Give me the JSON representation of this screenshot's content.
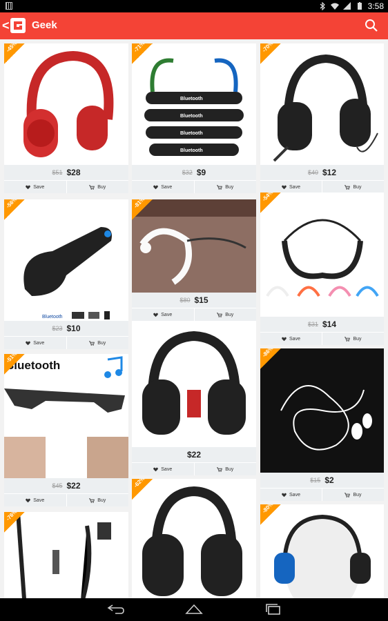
{
  "status_bar": {
    "time": "3:58"
  },
  "app_bar": {
    "back_glyph": "<",
    "title": "Geek"
  },
  "colors": {
    "accent": "#f44336",
    "badge": "#ff9800"
  },
  "products": [
    {
      "discount": "-45%",
      "old_price": "$51",
      "price": "$28",
      "save": "Save",
      "buy": "Buy",
      "image": "red-headphones"
    },
    {
      "discount": "-71%",
      "old_price": "$32",
      "price": "$9",
      "save": "Save",
      "buy": "Buy",
      "image": "bluetooth-neckband-headsets",
      "image_text": [
        "Bluetooth",
        "Bluetooth",
        "Bluetooth",
        "Bluetooth"
      ]
    },
    {
      "discount": "-70%",
      "old_price": "$40",
      "price": "$12",
      "save": "Save",
      "buy": "Buy",
      "image": "black-gaming-headset"
    },
    {
      "discount": "-56%",
      "old_price": "$23",
      "price": "$10",
      "save": "Save",
      "buy": "Buy",
      "image": "bluetooth-earpiece",
      "image_text": [
        "Bluetooth"
      ]
    },
    {
      "discount": "-81%",
      "old_price": "$80",
      "price": "$15",
      "save": "Save",
      "buy": "Buy",
      "image": "white-neckband-headphones"
    },
    {
      "discount": "-54%",
      "old_price": "$31",
      "price": "$14",
      "save": "Save",
      "buy": "Buy",
      "image": "neckband-headphones-colors"
    },
    {
      "discount": "-51%",
      "old_price": "$45",
      "price": "$22",
      "save": "Save",
      "buy": "Buy",
      "image": "bluetooth-sunglasses",
      "image_text": [
        "Bluetooth"
      ]
    },
    {
      "discount": "",
      "old_price": "",
      "price": "$22",
      "save": "Save",
      "buy": "Buy",
      "image": "black-red-gaming-headset"
    },
    {
      "discount": "-86%",
      "old_price": "$15",
      "price": "$2",
      "save": "Save",
      "buy": "Buy",
      "image": "white-earphones"
    },
    {
      "discount": "-76%",
      "old_price": "",
      "price": "",
      "save": "",
      "buy": "",
      "image": "zipper-earphones"
    },
    {
      "discount": "-62%",
      "old_price": "",
      "price": "",
      "save": "",
      "buy": "",
      "image": "foldable-headphones"
    },
    {
      "discount": "-80%",
      "old_price": "",
      "price": "",
      "save": "",
      "buy": "",
      "image": "headset-mannequin"
    }
  ]
}
